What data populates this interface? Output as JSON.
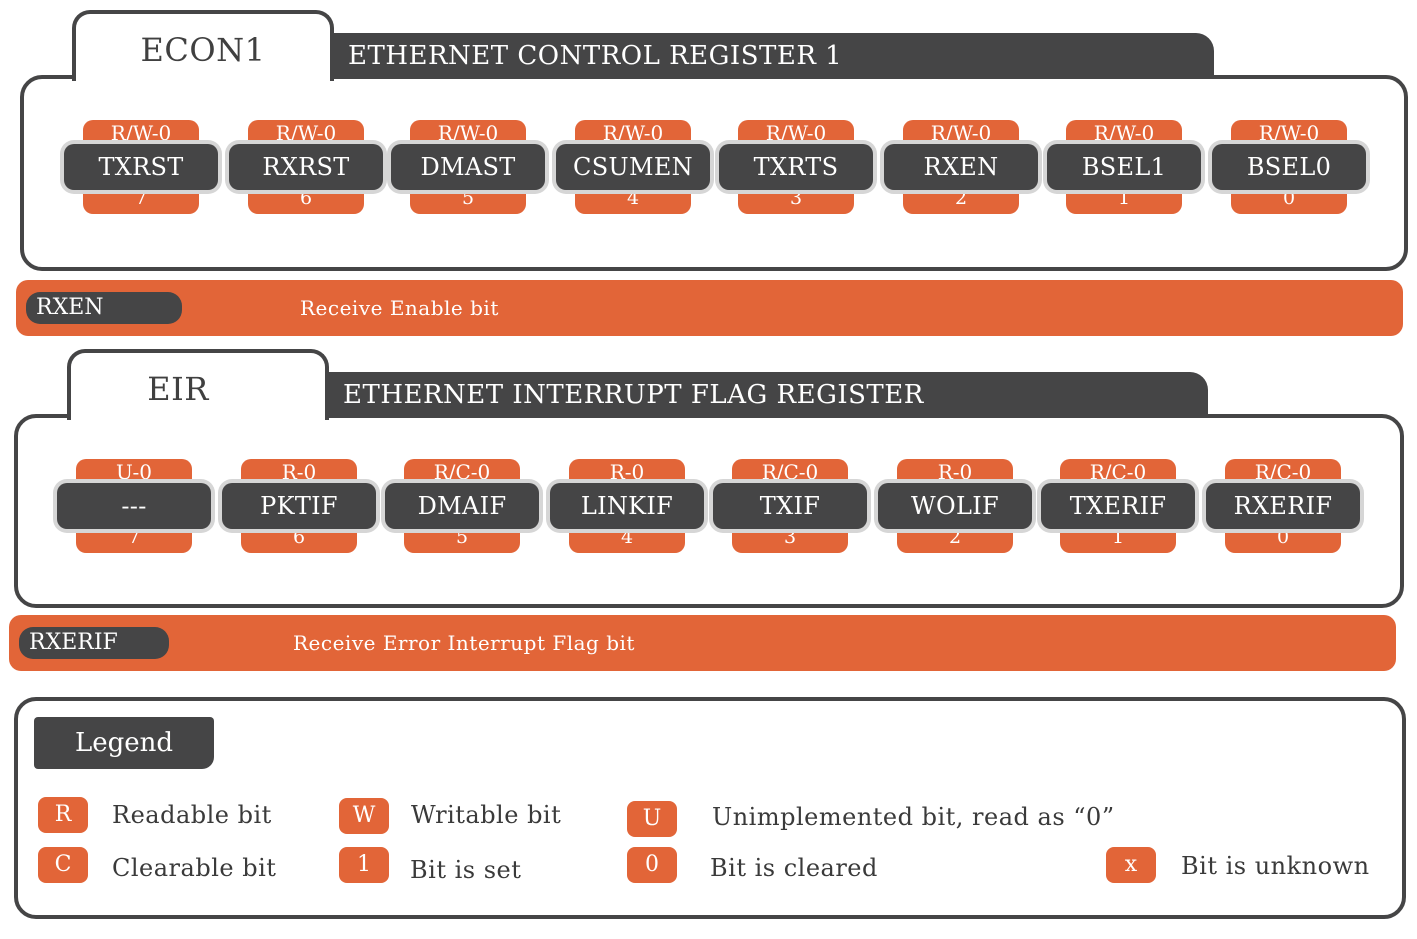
{
  "econ1": {
    "tab_label": "ECON1",
    "title": "ETHERNET CONTROL REGISTER 1",
    "bits": [
      {
        "access": "R/W-0",
        "name": "TXRST",
        "number": "7"
      },
      {
        "access": "R/W-0",
        "name": "RXRST",
        "number": "6"
      },
      {
        "access": "R/W-0",
        "name": "DMAST",
        "number": "5"
      },
      {
        "access": "R/W-0",
        "name": "CSUMEN",
        "number": "4"
      },
      {
        "access": "R/W-0",
        "name": "TXRTS",
        "number": "3"
      },
      {
        "access": "R/W-0",
        "name": "RXEN",
        "number": "2"
      },
      {
        "access": "R/W-0",
        "name": "BSEL1",
        "number": "1"
      },
      {
        "access": "R/W-0",
        "name": "BSEL0",
        "number": "0"
      }
    ],
    "description": {
      "bit": "RXEN",
      "text": "Receive Enable bit"
    }
  },
  "eir": {
    "tab_label": "EIR",
    "title": "ETHERNET INTERRUPT FLAG REGISTER",
    "bits": [
      {
        "access": "U-0",
        "name": "---",
        "number": "7"
      },
      {
        "access": "R-0",
        "name": "PKTIF",
        "number": "6"
      },
      {
        "access": "R/C-0",
        "name": "DMAIF",
        "number": "5"
      },
      {
        "access": "R-0",
        "name": "LINKIF",
        "number": "4"
      },
      {
        "access": "R/C-0",
        "name": "TXIF",
        "number": "3"
      },
      {
        "access": "R-0",
        "name": "WOLIF",
        "number": "2"
      },
      {
        "access": "R/C-0",
        "name": "TXERIF",
        "number": "1"
      },
      {
        "access": "R/C-0",
        "name": "RXERIF",
        "number": "0"
      }
    ],
    "description": {
      "bit": "RXERIF",
      "text": "Receive Error Interrupt Flag bit"
    }
  },
  "legend": {
    "title": "Legend",
    "items": [
      {
        "key": "R",
        "text": "Readable bit"
      },
      {
        "key": "W",
        "text": "Writable bit"
      },
      {
        "key": "U",
        "text": "Unimplemented bit, read as “0”"
      },
      {
        "key": "C",
        "text": "Clearable bit"
      },
      {
        "key": "1",
        "text": "Bit is set"
      },
      {
        "key": "0",
        "text": "Bit is cleared"
      },
      {
        "key": "x",
        "text": "Bit is unknown"
      }
    ]
  }
}
